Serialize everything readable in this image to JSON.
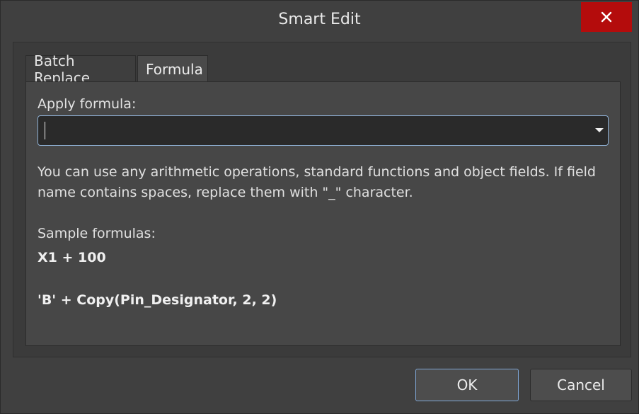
{
  "window": {
    "title": "Smart Edit",
    "close_icon": "close-icon"
  },
  "tabs": [
    {
      "label": "Batch Replace",
      "active": false
    },
    {
      "label": "Formula",
      "active": true
    }
  ],
  "formula": {
    "label": "Apply formula:",
    "value": ""
  },
  "help_text": "You can use any arithmetic operations, standard functions and object fields. If field name contains spaces, replace them with \"_\" character.",
  "samples": {
    "label": "Sample formulas:",
    "items": [
      "X1 + 100",
      "'B' + Copy(Pin_Designator, 2, 2)"
    ]
  },
  "buttons": {
    "ok": "OK",
    "cancel": "Cancel"
  },
  "colors": {
    "close_button": "#b40c0c",
    "focus_border": "#8fb0d4",
    "background": "#404040"
  }
}
